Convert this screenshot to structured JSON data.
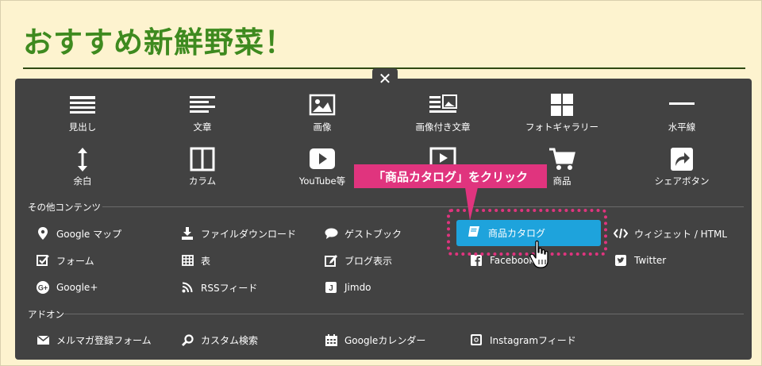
{
  "page_title": "おすすめ新鮮野菜！",
  "close_label": "✕",
  "tiles": [
    {
      "label": "見出し",
      "icon": "heading-icon"
    },
    {
      "label": "文章",
      "icon": "text-icon"
    },
    {
      "label": "画像",
      "icon": "image-icon"
    },
    {
      "label": "画像付き文章",
      "icon": "image-text-icon"
    },
    {
      "label": "フォトギャラリー",
      "icon": "gallery-icon"
    },
    {
      "label": "水平線",
      "icon": "horizontal-line-icon"
    },
    {
      "label": "余白",
      "icon": "spacing-icon"
    },
    {
      "label": "カラム",
      "icon": "column-icon"
    },
    {
      "label": "YouTube等",
      "icon": "youtube-icon"
    },
    {
      "label": "",
      "icon": "video-icon"
    },
    {
      "label": "商品",
      "icon": "cart-icon"
    },
    {
      "label": "シェアボタン",
      "icon": "share-icon"
    }
  ],
  "sections": {
    "other": "その他コンテンツ",
    "addon": "アドオン"
  },
  "other_items": [
    {
      "label": "Google マップ",
      "icon": "map-pin-icon"
    },
    {
      "label": "ファイルダウンロード",
      "icon": "download-icon"
    },
    {
      "label": "ゲストブック",
      "icon": "speech-bubble-icon"
    },
    {
      "label": "商品カタログ",
      "icon": "book-icon"
    },
    {
      "label": "ウィジェット / HTML",
      "icon": "code-icon"
    },
    {
      "label": "フォーム",
      "icon": "checkbox-icon"
    },
    {
      "label": "表",
      "icon": "table-icon"
    },
    {
      "label": "ブログ表示",
      "icon": "edit-icon"
    },
    {
      "label": "Facebook",
      "icon": "facebook-icon"
    },
    {
      "label": "Twitter",
      "icon": "twitter-icon"
    },
    {
      "label": "Google+",
      "icon": "googleplus-icon"
    },
    {
      "label": "RSSフィード",
      "icon": "rss-icon"
    },
    {
      "label": "Jimdo",
      "icon": "jimdo-icon"
    }
  ],
  "addon_items": [
    {
      "label": "メルマガ登録フォーム",
      "icon": "mail-icon"
    },
    {
      "label": "カスタム検索",
      "icon": "search-icon"
    },
    {
      "label": "Googleカレンダー",
      "icon": "calendar-icon"
    },
    {
      "label": "Instagramフィード",
      "icon": "instagram-icon"
    }
  ],
  "callout": "「商品カタログ」をクリック",
  "colors": {
    "title_green": "#3e8a1f",
    "panel": "#424242",
    "highlight_blue": "#1ea3dc",
    "callout_pink": "#e0347e",
    "page_bg": "#fdf3cf"
  }
}
